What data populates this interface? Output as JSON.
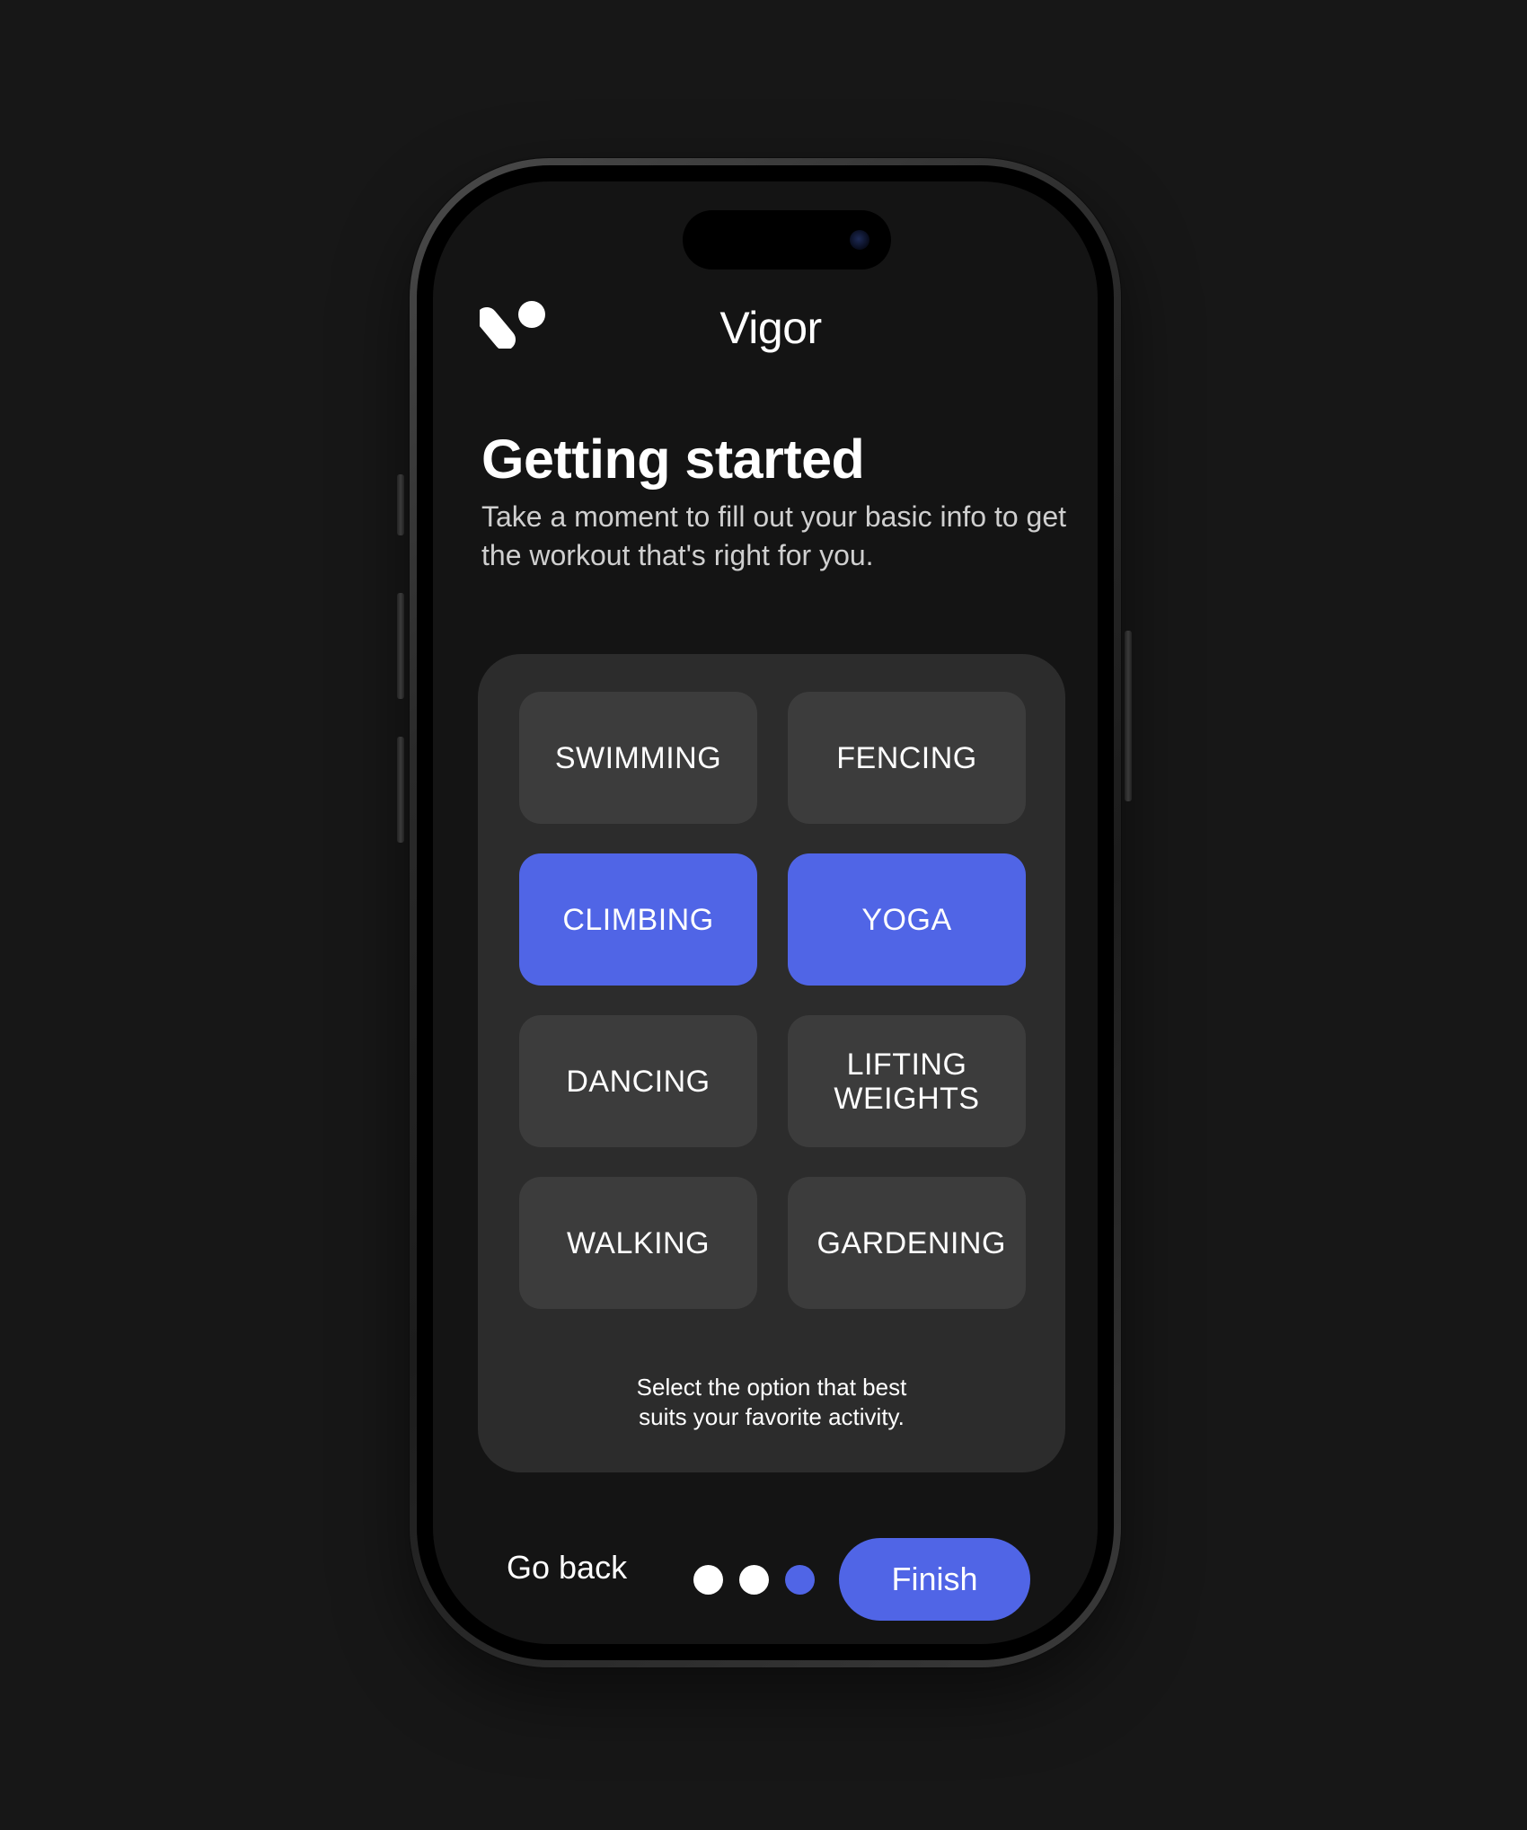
{
  "app": {
    "name": "Vigor",
    "logo_icon": "vigor-logo-icon"
  },
  "intro": {
    "title": "Getting started",
    "subtitle": "Take a moment to fill out your basic info to get the workout that's right for you."
  },
  "activities": {
    "options": [
      {
        "label": "SWIMMING",
        "selected": false
      },
      {
        "label": "FENCING",
        "selected": false
      },
      {
        "label": "CLIMBING",
        "selected": true
      },
      {
        "label": "YOGA",
        "selected": true
      },
      {
        "label": "DANCING",
        "selected": false
      },
      {
        "label": "LIFTING WEIGHTS",
        "selected": false
      },
      {
        "label": "WALKING",
        "selected": false
      },
      {
        "label": "GARDENING",
        "selected": false
      }
    ],
    "hint": "Select the option that best suits your favorite activity."
  },
  "footer": {
    "back_label": "Go back",
    "finish_label": "Finish",
    "progress": {
      "total_steps": 3,
      "current_step": 3
    }
  },
  "colors": {
    "accent": "#5065e6",
    "background": "#141414",
    "card": "#2c2c2c",
    "option": "#3c3c3c",
    "text": "#ffffff"
  }
}
